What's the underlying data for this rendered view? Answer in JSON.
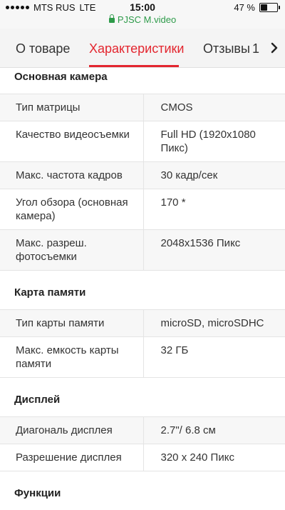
{
  "status_bar": {
    "carrier": "MTS RUS",
    "network": "LTE",
    "time": "15:00",
    "url": "PJSC M.video",
    "battery_text": "47 %",
    "battery_level": 0.47
  },
  "tabs": [
    {
      "label": "О товаре"
    },
    {
      "label": "Характеристики",
      "active": true
    },
    {
      "label": "Отзывы"
    },
    {
      "label": "1"
    }
  ],
  "sections": {
    "camera": {
      "title": "Основная камера",
      "rows": [
        {
          "key": "Тип матрицы",
          "value": "CMOS"
        },
        {
          "key": "Качество видеосъемки",
          "value": "Full HD (1920x1080 Пикс)"
        },
        {
          "key": "Макс. частота кадров",
          "value": "30 кадр/сек"
        },
        {
          "key": "Угол обзора (основная камера)",
          "value": "170 *"
        },
        {
          "key": "Макс. разреш. фотосъемки",
          "value": "2048x1536 Пикс"
        }
      ]
    },
    "memory": {
      "title": "Карта памяти",
      "rows": [
        {
          "key": "Тип карты памяти",
          "value": "microSD, microSDHC"
        },
        {
          "key": "Макс. емкость карты памяти",
          "value": "32 ГБ"
        }
      ]
    },
    "display": {
      "title": "Дисплей",
      "rows": [
        {
          "key": "Диагональ дисплея",
          "value": "2.7\"/ 6.8 см"
        },
        {
          "key": "Разрешение дисплея",
          "value": "320 x 240 Пикс"
        }
      ]
    },
    "functions": {
      "title": "Функции"
    }
  },
  "colors": {
    "accent": "#e3262f",
    "secure_url": "#2e9b4a"
  }
}
